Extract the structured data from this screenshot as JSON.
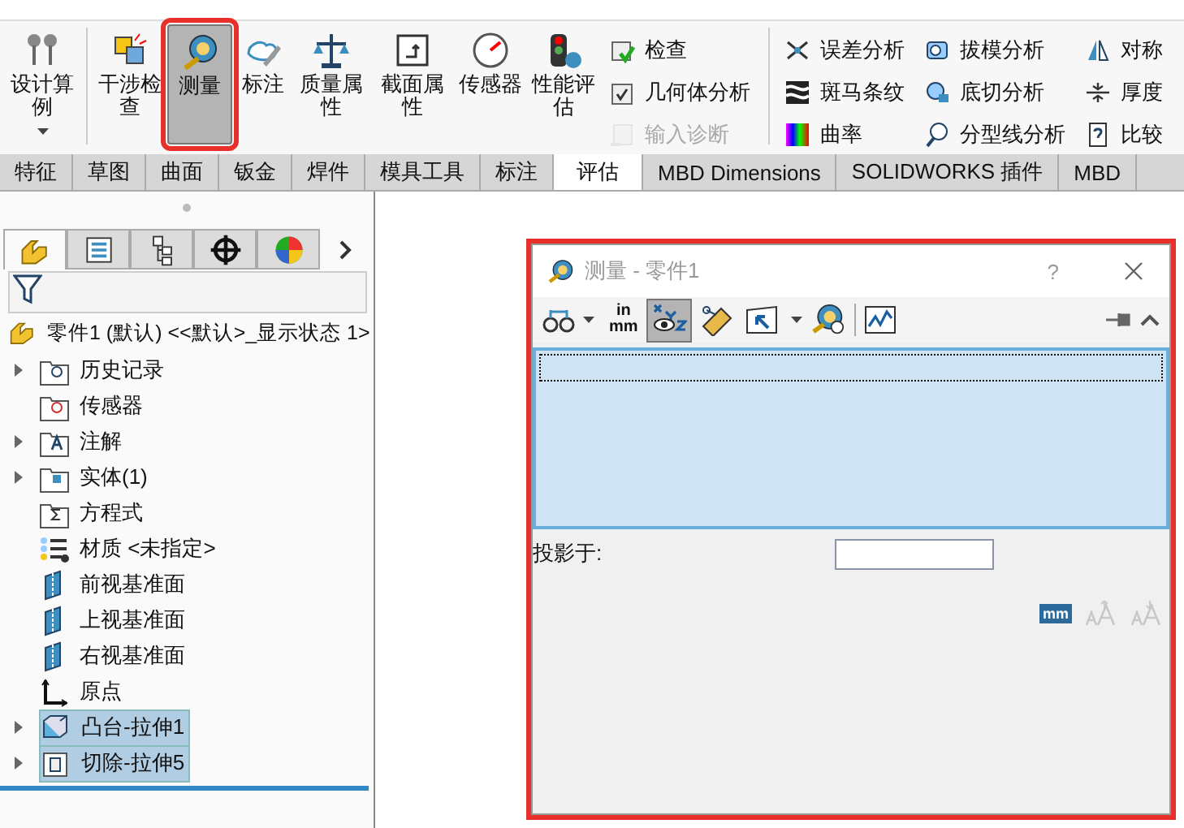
{
  "ribbon": {
    "large_buttons": [
      {
        "label": "设计算例",
        "selected": false,
        "dropdown": true,
        "highlighted": false
      },
      {
        "label": "干涉检查",
        "selected": false,
        "dropdown": false,
        "highlighted": false
      },
      {
        "label": "测量",
        "selected": true,
        "dropdown": false,
        "highlighted": true
      },
      {
        "label": "标注",
        "selected": false,
        "dropdown": false,
        "highlighted": false
      },
      {
        "label": "质量属性",
        "selected": false,
        "dropdown": false,
        "highlighted": false
      },
      {
        "label": "截面属性",
        "selected": false,
        "dropdown": false,
        "highlighted": false
      },
      {
        "label": "传感器",
        "selected": false,
        "dropdown": false,
        "highlighted": false
      },
      {
        "label": "性能评估",
        "selected": false,
        "dropdown": false,
        "highlighted": false
      }
    ],
    "small_columns": [
      [
        {
          "label": "检查",
          "disabled": false
        },
        {
          "label": "几何体分析",
          "disabled": false
        },
        {
          "label": "输入诊断",
          "disabled": true
        }
      ],
      [
        {
          "label": "误差分析",
          "disabled": false
        },
        {
          "label": "斑马条纹",
          "disabled": false
        },
        {
          "label": "曲率",
          "disabled": false
        }
      ],
      [
        {
          "label": "拔模分析",
          "disabled": false
        },
        {
          "label": "底切分析",
          "disabled": false
        },
        {
          "label": "分型线分析",
          "disabled": false
        }
      ],
      [
        {
          "label": "对称",
          "disabled": false
        },
        {
          "label": "厚度",
          "disabled": false
        },
        {
          "label": "比较",
          "disabled": false
        }
      ]
    ]
  },
  "tabs": [
    {
      "label": "特征",
      "selected": false
    },
    {
      "label": "草图",
      "selected": false
    },
    {
      "label": "曲面",
      "selected": false
    },
    {
      "label": "钣金",
      "selected": false
    },
    {
      "label": "焊件",
      "selected": false
    },
    {
      "label": "模具工具",
      "selected": false
    },
    {
      "label": "标注",
      "selected": false
    },
    {
      "label": "评估",
      "selected": true
    },
    {
      "label": "MBD Dimensions",
      "selected": false
    },
    {
      "label": "SOLIDWORKS 插件",
      "selected": false
    },
    {
      "label": "MBD",
      "selected": false
    }
  ],
  "panel_tabs": [
    {
      "selected": true
    },
    {
      "selected": false
    },
    {
      "selected": false
    },
    {
      "selected": false
    },
    {
      "selected": false
    }
  ],
  "feature_tree": {
    "root": "零件1 (默认) <<默认>_显示状态 1>",
    "items": [
      {
        "label": "历史记录",
        "expandable": true,
        "selected": false
      },
      {
        "label": "传感器",
        "expandable": false,
        "selected": false
      },
      {
        "label": "注解",
        "expandable": true,
        "selected": false
      },
      {
        "label": "实体(1)",
        "expandable": true,
        "selected": false
      },
      {
        "label": "方程式",
        "expandable": false,
        "selected": false
      },
      {
        "label": "材质 <未指定>",
        "expandable": false,
        "selected": false
      },
      {
        "label": "前视基准面",
        "expandable": false,
        "selected": false
      },
      {
        "label": "上视基准面",
        "expandable": false,
        "selected": false
      },
      {
        "label": "右视基准面",
        "expandable": false,
        "selected": false
      },
      {
        "label": "原点",
        "expandable": false,
        "selected": false
      },
      {
        "label": "凸台-拉伸1",
        "expandable": true,
        "selected": true
      },
      {
        "label": "切除-拉伸5",
        "expandable": true,
        "selected": true
      }
    ]
  },
  "dialog": {
    "title": "测量 - 零件1",
    "highlighted": true,
    "help": "?",
    "units_button": [
      "in",
      "mm"
    ],
    "xyz_toggle": {
      "selected": true
    },
    "projection_label": "投影于:",
    "units_badge": "mm",
    "font_buttons": [
      {
        "disabled": true
      },
      {
        "disabled": true
      }
    ]
  }
}
